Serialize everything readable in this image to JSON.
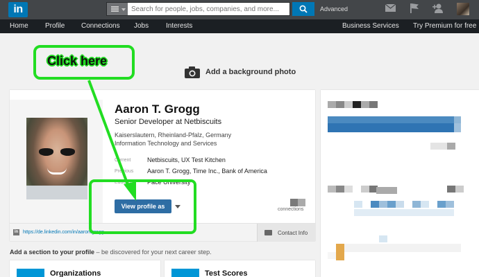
{
  "topbar": {
    "logo": "in",
    "search_placeholder": "Search for people, jobs, companies, and more...",
    "advanced": "Advanced",
    "icons": [
      "search-category-icon",
      "search-icon",
      "messages-icon",
      "notifications-flag-icon",
      "add-connections-icon",
      "profile-avatar"
    ]
  },
  "nav": {
    "items": [
      "Home",
      "Profile",
      "Connections",
      "Jobs",
      "Interests"
    ],
    "right": [
      "Business Services",
      "Try Premium for free"
    ]
  },
  "cover": {
    "label": "Add a background photo"
  },
  "profile": {
    "name": "Aaron T. Grogg",
    "headline": "Senior Developer at Netbiscuits",
    "location": "Kaiserslautern, Rheinland-Pfalz, Germany",
    "industry": "Information Technology and Services",
    "rows": [
      {
        "label": "Current",
        "value": "Netbiscuits, UX Test Kitchen"
      },
      {
        "label": "Previous",
        "value": "Aaron T. Grogg, Time Inc., Bank of America"
      },
      {
        "label": "Education",
        "value": "Pace University"
      }
    ],
    "view_button": "View profile as",
    "connections_label": "connections",
    "url": "https://de.linkedin.com/in/aarontgrogg",
    "contact": "Contact Info"
  },
  "add_section": {
    "strong": "Add a section to your profile",
    "rest": " – be discovered for your next career step.",
    "tiles": [
      "Organizations",
      "Test Scores"
    ]
  },
  "annotation": {
    "callout": "Click here"
  },
  "colors": {
    "linkedin_blue": "#0077b5",
    "button_blue": "#2e6da4",
    "highlight_green": "#22dd22",
    "topbar": "#434649",
    "navbar": "#1b1f23"
  }
}
